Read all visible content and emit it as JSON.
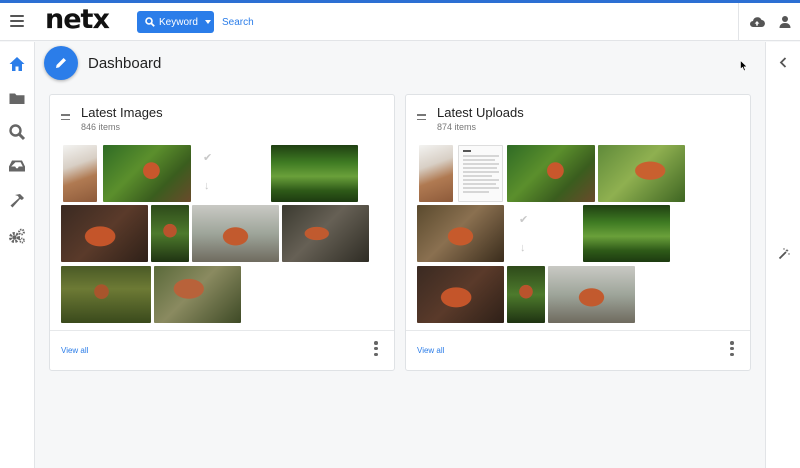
{
  "app": {
    "logo": "netx"
  },
  "header": {
    "search_mode": "Keyword",
    "search_placeholder": "Search",
    "icons": [
      "menu-icon",
      "cloud-upload-icon",
      "user-icon"
    ]
  },
  "sidebar": {
    "items": [
      {
        "name": "home-icon"
      },
      {
        "name": "folder-icon"
      },
      {
        "name": "search-icon"
      },
      {
        "name": "inbox-icon"
      },
      {
        "name": "hammer-icon"
      },
      {
        "name": "settings-icon"
      }
    ]
  },
  "right_panel": {
    "icons": [
      "chevron-left-icon",
      "magic-wand-icon"
    ]
  },
  "page": {
    "title": "Dashboard"
  },
  "widgets": [
    {
      "title": "Latest Images",
      "count": "846 items",
      "view_all": "View all"
    },
    {
      "title": "Latest Uploads",
      "count": "874 items",
      "view_all": "View all"
    }
  ],
  "colors": {
    "accent": "#2b7de9",
    "top_stripe": "#2c6fd3"
  }
}
